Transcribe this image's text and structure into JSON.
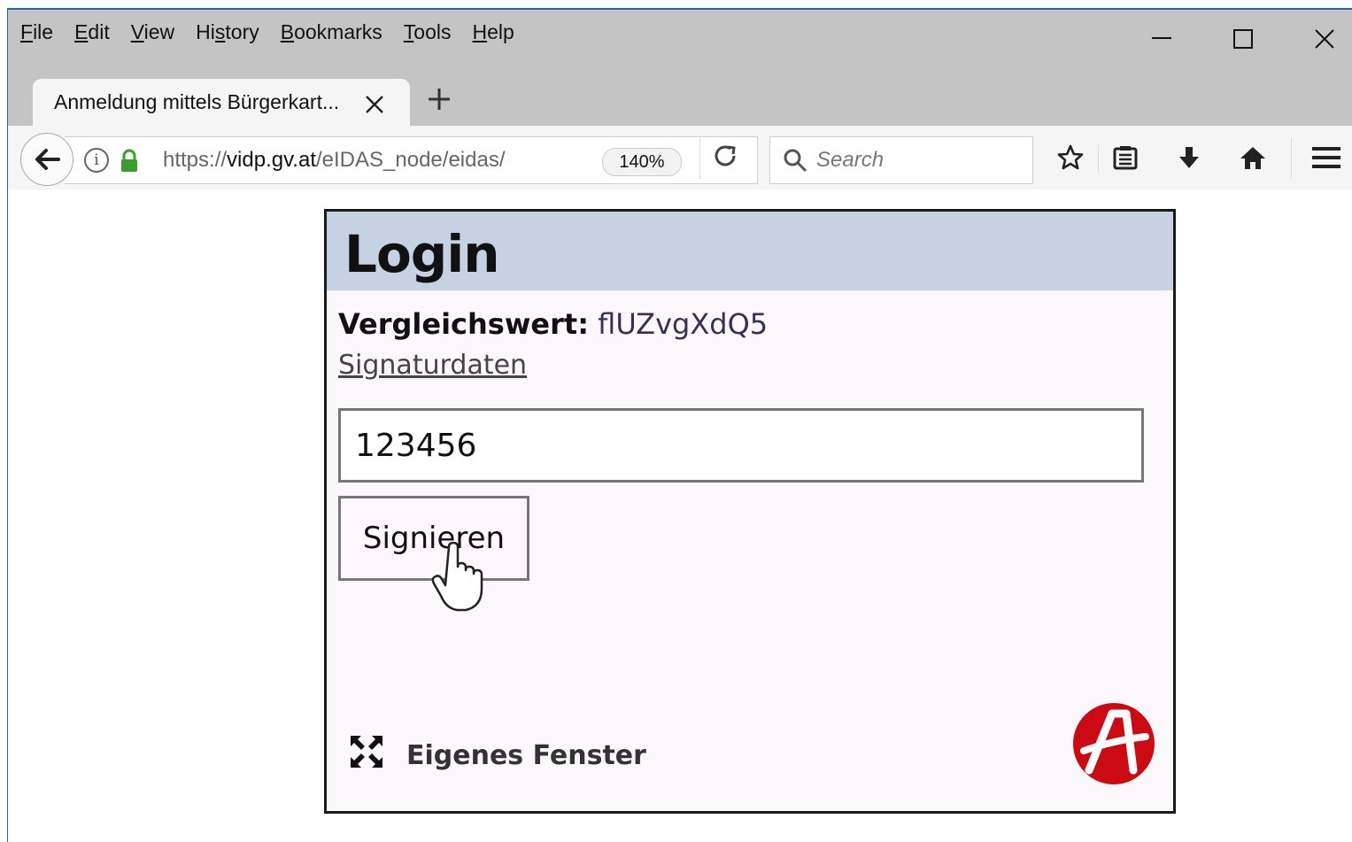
{
  "menu": [
    "File",
    "Edit",
    "View",
    "History",
    "Bookmarks",
    "Tools",
    "Help"
  ],
  "menu_mnemonics": [
    "F",
    "E",
    "V",
    "s",
    "B",
    "T",
    "H"
  ],
  "tab": {
    "title": "Anmeldung mittels Bürgerkart..."
  },
  "urlbar": {
    "scheme": "https://",
    "host": "vidp.gv.at",
    "path": "/eIDAS_node/eidas/",
    "zoom": "140%"
  },
  "search": {
    "placeholder": "Search"
  },
  "login": {
    "title": "Login",
    "vergleich_label": "Vergleichswert:",
    "vergleich_value": "flUZvgXdQ5",
    "signaturdaten_link": "Signaturdaten",
    "pin_value": "123456",
    "sign_button": "Signieren",
    "eigenes_fenster": "Eigenes Fenster"
  },
  "colors": {
    "chrome": "#c4c4c4",
    "header_bar": "#c6d2e2",
    "logo_red": "#cc0a14",
    "accent_blue": "#2b5fb5"
  },
  "icons": [
    "back-arrow-icon",
    "info-icon",
    "lock-icon",
    "reload-icon",
    "search-icon",
    "star-icon",
    "reading-list-icon",
    "download-icon",
    "home-icon",
    "hamburger-menu-icon",
    "minimize-icon",
    "maximize-icon",
    "close-icon",
    "expand-icon",
    "a-trust-logo",
    "hand-cursor-icon"
  ]
}
